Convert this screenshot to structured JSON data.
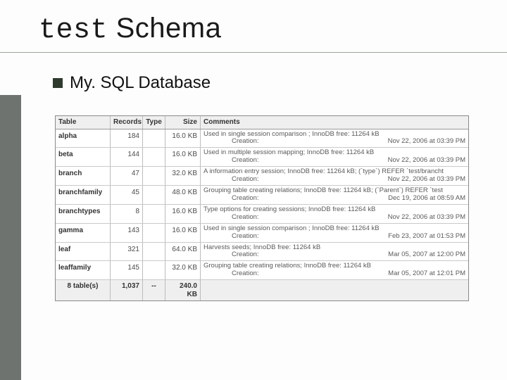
{
  "title": {
    "mono": "test",
    "rest": " Schema"
  },
  "bullet": "My. SQL Database",
  "headers": {
    "table": "Table",
    "records": "Records",
    "type": "Type",
    "size": "Size",
    "comments": "Comments"
  },
  "creation_label": "Creation:",
  "rows": [
    {
      "name": "alpha",
      "records": "184",
      "type": "",
      "size": "16.0 KB",
      "comment": "Used in single session comparison ; InnoDB free: 11264 kB",
      "created": "Nov 22, 2006 at 03:39 PM"
    },
    {
      "name": "beta",
      "records": "144",
      "type": "",
      "size": "16.0 KB",
      "comment": "Used in multiple session mapping; InnoDB free: 11264 kB",
      "created": "Nov 22, 2006 at 03:39 PM"
    },
    {
      "name": "branch",
      "records": "47",
      "type": "",
      "size": "32.0 KB",
      "comment": "A information entry session; InnoDB free: 11264 kB; (`type`) REFER `test/brancht",
      "created": "Nov 22, 2006 at 03:39 PM"
    },
    {
      "name": "branchfamily",
      "records": "45",
      "type": "",
      "size": "48.0 KB",
      "comment": "Grouping table creating relations; InnoDB free: 11264 kB; (`Parent`) REFER `test",
      "created": "Dec 19, 2006 at 08:59 AM"
    },
    {
      "name": "branchtypes",
      "records": "8",
      "type": "",
      "size": "16.0 KB",
      "comment": "Type options for creating sessions; InnoDB free: 11264 kB",
      "created": "Nov 22, 2006 at 03:39 PM"
    },
    {
      "name": "gamma",
      "records": "143",
      "type": "",
      "size": "16.0 KB",
      "comment": "Used in single session comparison ; InnoDB free: 11264 kB",
      "created": "Feb 23, 2007 at 01:53 PM"
    },
    {
      "name": "leaf",
      "records": "321",
      "type": "",
      "size": "64.0 KB",
      "comment": "Harvests seeds; InnoDB free: 11264 kB",
      "created": "Mar 05, 2007 at 12:00 PM"
    },
    {
      "name": "leaffamily",
      "records": "145",
      "type": "",
      "size": "32.0 KB",
      "comment": "Grouping table creating relations; InnoDB free: 11264 kB",
      "created": "Mar 05, 2007 at 12:01 PM"
    }
  ],
  "footer": {
    "tables_label": "8 table(s)",
    "records": "1,037",
    "type": "--",
    "size": "240.0 KB"
  }
}
